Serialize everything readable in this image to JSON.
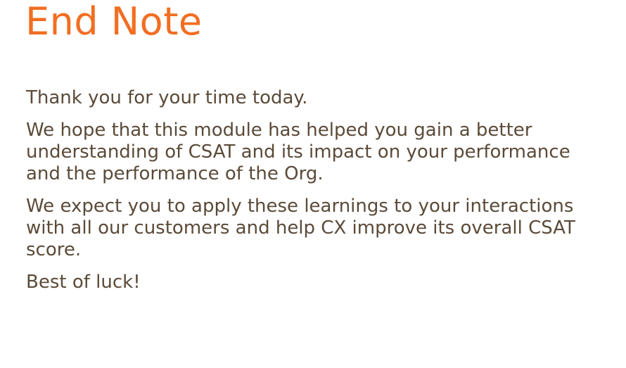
{
  "slide": {
    "title": "End Note",
    "paragraphs": [
      "Thank you for your time today.",
      "We hope that this module has helped you gain a better understanding of CSAT and its impact on your performance and the performance of the Org.",
      "We expect you to apply these learnings to your interactions with all our customers and help CX improve its overall CSAT score.",
      "Best of luck!"
    ]
  },
  "colors": {
    "title": "#f26e22",
    "body_text": "#5b4a38",
    "background": "#ffffff"
  }
}
